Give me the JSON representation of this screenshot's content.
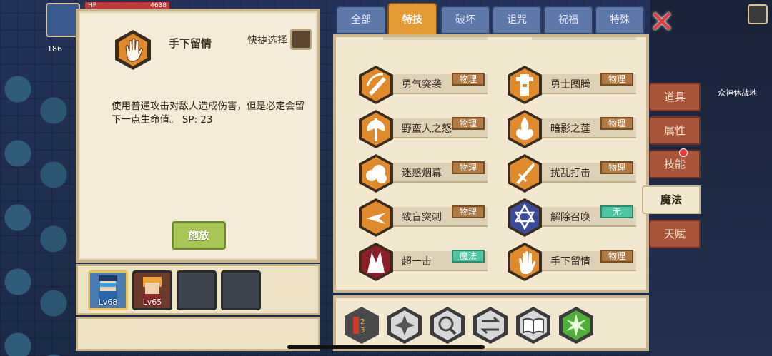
{
  "hud": {
    "hp_label": "HP",
    "hp_value": "4638",
    "level_badge": "186"
  },
  "detail": {
    "title": "手下留情",
    "quick_select_label": "快捷选择",
    "description": "使用普通攻击对敌人造成伤害，但是必定会留下一点生命值。  SP: 23",
    "cast_button": "施放"
  },
  "party": [
    {
      "level": "Lv68",
      "active": true
    },
    {
      "level": "Lv65",
      "active": false
    },
    {
      "level": "",
      "active": false
    },
    {
      "level": "",
      "active": false
    }
  ],
  "tabs": [
    {
      "label": "全部",
      "selected": false
    },
    {
      "label": "特技",
      "selected": true
    },
    {
      "label": "破坏",
      "selected": false
    },
    {
      "label": "诅咒",
      "selected": false
    },
    {
      "label": "祝福",
      "selected": false
    },
    {
      "label": "特殊",
      "selected": false
    }
  ],
  "close_icon": "close-x-icon",
  "skills": [
    {
      "name": "勇气突袭",
      "tag": "物理",
      "tag_type": "physical",
      "icon": "sword-slash-icon",
      "color": "#e08a2c"
    },
    {
      "name": "勇士图腾",
      "tag": "物理",
      "tag_type": "physical",
      "icon": "totem-icon",
      "color": "#e08a2c"
    },
    {
      "name": "野蛮人之怒",
      "tag": "物理",
      "tag_type": "physical",
      "icon": "axe-icon",
      "color": "#e08a2c"
    },
    {
      "name": "暗影之莲",
      "tag": "物理",
      "tag_type": "physical",
      "icon": "flame-lotus-icon",
      "color": "#e08a2c"
    },
    {
      "name": "迷惑烟幕",
      "tag": "物理",
      "tag_type": "physical",
      "icon": "smoke-icon",
      "color": "#e08a2c"
    },
    {
      "name": "扰乱打击",
      "tag": "物理",
      "tag_type": "physical",
      "icon": "dagger-strike-icon",
      "color": "#e08a2c"
    },
    {
      "name": "致盲突刺",
      "tag": "物理",
      "tag_type": "physical",
      "icon": "bird-strike-icon",
      "color": "#e08a2c"
    },
    {
      "name": "解除召唤",
      "tag": "无",
      "tag_type": "none",
      "icon": "hexagram-icon",
      "color": "#3b4a9a"
    },
    {
      "name": "超一击",
      "tag": "魔法",
      "tag_type": "magic",
      "icon": "crimson-strike-icon",
      "color": "#8a1f2a"
    },
    {
      "name": "手下留情",
      "tag": "物理",
      "tag_type": "physical",
      "icon": "open-hand-icon",
      "color": "#e08a2c"
    }
  ],
  "bottom_bar": [
    "numbered-list-icon",
    "shuriken-icon",
    "magnifier-icon",
    "swap-arrows-icon",
    "book-icon",
    "green-burst-icon"
  ],
  "side_menu": [
    {
      "label": "道具",
      "selected": false
    },
    {
      "label": "属性",
      "selected": false
    },
    {
      "label": "技能",
      "selected": false,
      "notify": true
    },
    {
      "label": "魔法",
      "selected": true
    },
    {
      "label": "天赋",
      "selected": false
    }
  ],
  "map_label": "众神休战地"
}
